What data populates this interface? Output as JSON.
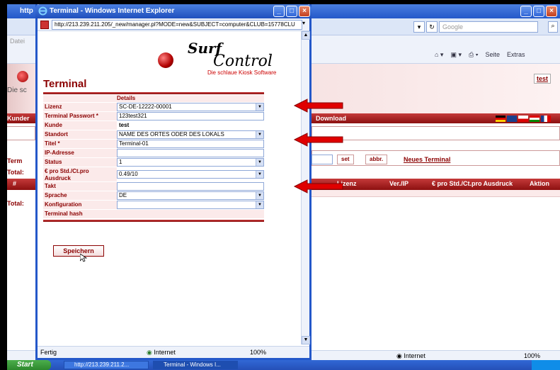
{
  "background": {
    "title": "http",
    "menu_text": "Datei",
    "search_placeholder": "Google",
    "tools": [
      "Seite",
      "Extras"
    ],
    "left_fragment": "Die sc",
    "test_link": "test",
    "nav_left": "Kunder",
    "nav_download": "Download",
    "term_label": "Term",
    "total1": "Total:",
    "total2": "Total:",
    "set_btn": "set",
    "abbr_btn": "abbr.",
    "neues_link": "Neues Terminal",
    "table_headers": [
      "Lizenz",
      "Ver./IP",
      "€ pro Std./Ct.pro Ausdruck",
      "Aktion"
    ],
    "status_zone": "Internet",
    "status_zoom": "100%"
  },
  "popup": {
    "title": "Terminal - Windows Internet Explorer",
    "url": "http://213.239.211.205/_new/manager.pl?MODE=new&SUBJECT=computer&CLUB=15778CLU",
    "logo_surf": "Surf",
    "logo_control": "Control",
    "logo_tagline": "Die schlaue Kiosk Software",
    "page_title": "Terminal",
    "details_header": "Details",
    "fields": {
      "lizenz": {
        "label": "Lizenz",
        "value": "SC-DE-12222-00001"
      },
      "passwort": {
        "label": "Terminal Passwort *",
        "value": "123test321"
      },
      "kunde": {
        "label": "Kunde",
        "value": "test"
      },
      "standort": {
        "label": "Standort",
        "value": "NAME DES ORTES ODER DES LOKALS"
      },
      "titel": {
        "label": "Titel *",
        "value": "Terminal-01"
      },
      "ip": {
        "label": "IP-Adresse",
        "value": ""
      },
      "status": {
        "label": "Status",
        "value": "1"
      },
      "preis": {
        "label": "€ pro Std./Ct.pro Ausdruck",
        "value": "0.49/10"
      },
      "takt": {
        "label": "Takt",
        "value": ""
      },
      "sprache": {
        "label": "Sprache",
        "value": "DE"
      },
      "konfiguration": {
        "label": "Konfiguration",
        "value": ""
      },
      "hash": {
        "label": "Terminal hash",
        "value": ""
      }
    },
    "save_button": "Speichern",
    "status_left": "Fertig",
    "status_zone": "Internet",
    "status_zoom": "100%"
  },
  "taskbar": {
    "start": "Start",
    "tasks": [
      "http://213.239.211.2...",
      "Terminal - Windows I..."
    ]
  },
  "colors": {
    "accent": "#8b0000",
    "arrow": "#e00000",
    "titlebar": "#2458c9"
  }
}
